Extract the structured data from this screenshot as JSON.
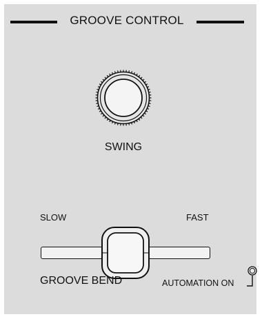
{
  "section": {
    "title": "GROOVE CONTROL"
  },
  "knob": {
    "label": "SWING",
    "icon": "rotary-knob-icon"
  },
  "fader": {
    "label": "GROOVE BEND",
    "left_label": "SLOW",
    "right_label": "FAST",
    "position": 0.5,
    "icon": "fader-cap-icon"
  },
  "automation": {
    "label": "AUTOMATION ON",
    "led_on": false,
    "icon": "led-indicator-icon"
  },
  "colors": {
    "panel": "#dcdcdc",
    "ink": "#111111",
    "knob_face": "#f4f4f4",
    "fader_cap": "#f0f0f0",
    "led": "#e8e8e8"
  }
}
